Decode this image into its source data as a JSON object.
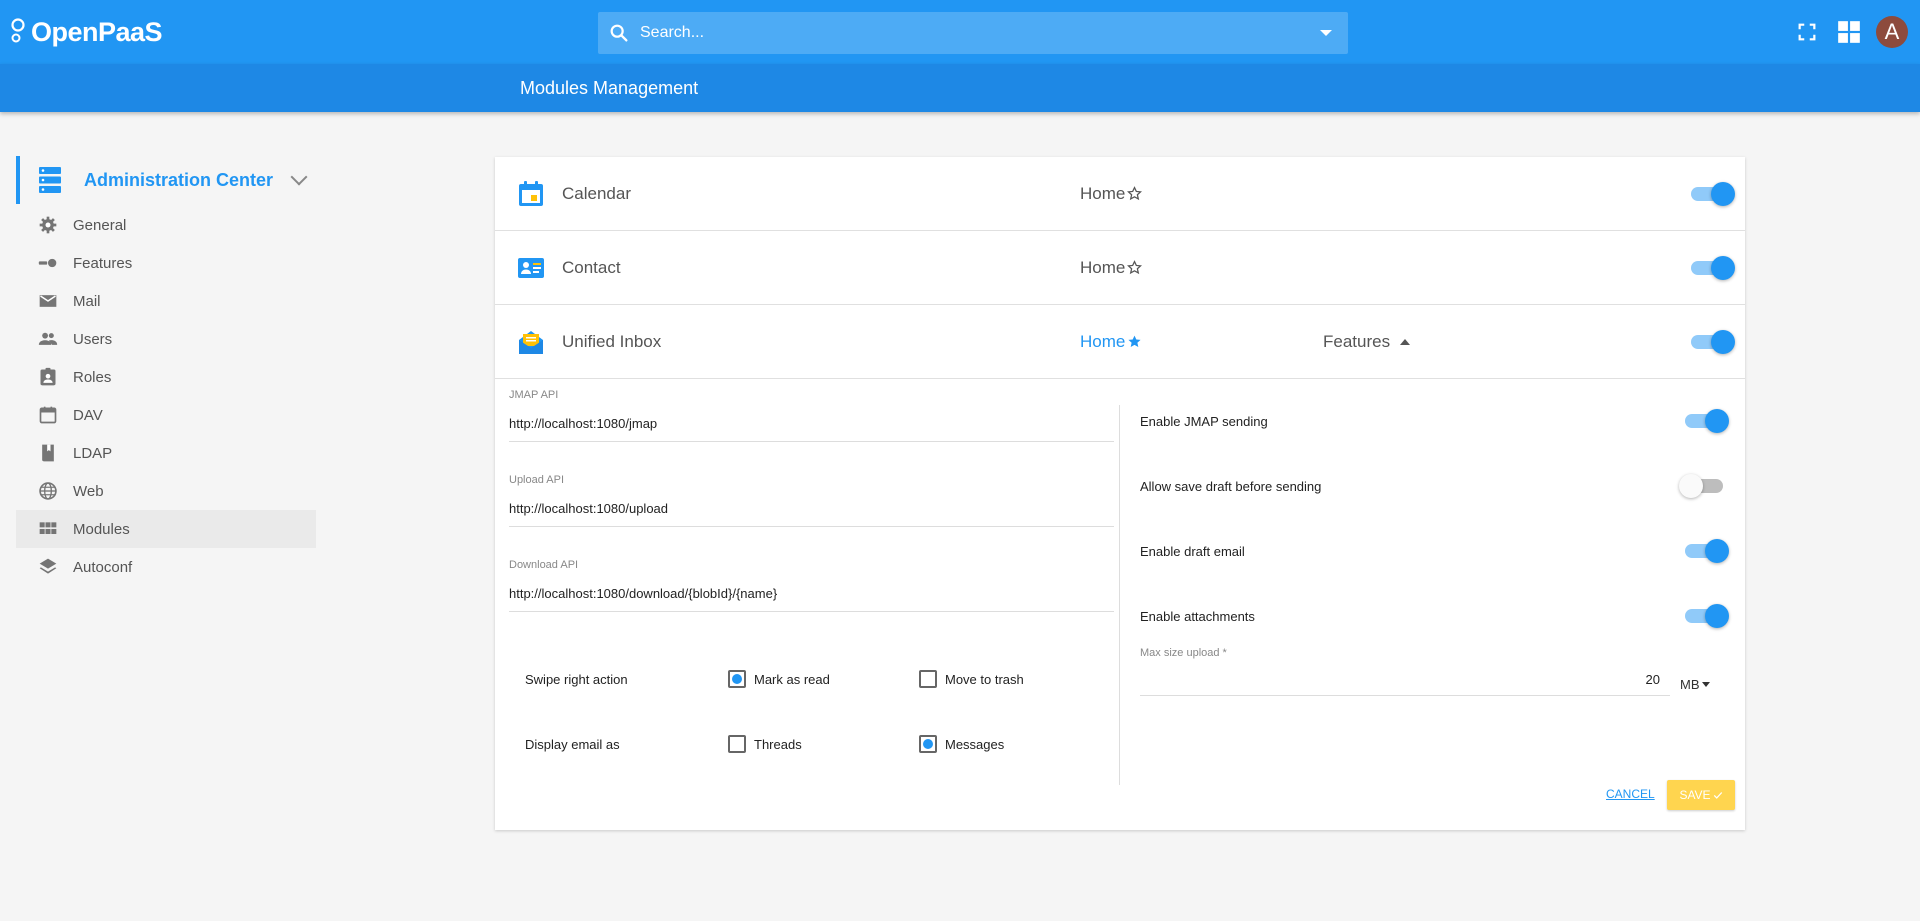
{
  "app": {
    "logo_text": "OpenPaaS"
  },
  "search": {
    "placeholder": "Search..."
  },
  "header": {
    "title": "Modules Management",
    "avatar_letter": "A"
  },
  "sidebar": {
    "title": "Administration Center",
    "items": [
      {
        "label": "General",
        "icon": "gear-icon"
      },
      {
        "label": "Features",
        "icon": "toggle-icon"
      },
      {
        "label": "Mail",
        "icon": "mail-icon"
      },
      {
        "label": "Users",
        "icon": "users-icon"
      },
      {
        "label": "Roles",
        "icon": "roles-icon"
      },
      {
        "label": "DAV",
        "icon": "calendar-icon"
      },
      {
        "label": "LDAP",
        "icon": "book-icon"
      },
      {
        "label": "Web",
        "icon": "globe-icon"
      },
      {
        "label": "Modules",
        "icon": "grid-icon"
      },
      {
        "label": "Autoconf",
        "icon": "layers-icon"
      }
    ]
  },
  "modules": [
    {
      "name": "Calendar",
      "home": "Home",
      "enabled": true
    },
    {
      "name": "Contact",
      "home": "Home",
      "enabled": true
    },
    {
      "name": "Unified Inbox",
      "home": "Home",
      "features_label": "Features",
      "enabled": true
    }
  ],
  "inbox_config": {
    "jmap_api": {
      "label": "JMAP API",
      "value": "http://localhost:1080/jmap"
    },
    "upload_api": {
      "label": "Upload API",
      "value": "http://localhost:1080/upload"
    },
    "download_api": {
      "label": "Download API",
      "value": "http://localhost:1080/download/{blobId}/{name}"
    },
    "swipe_right": {
      "label": "Swipe right action",
      "option1": "Mark as read",
      "option2": "Move to trash",
      "selected": "Mark as read"
    },
    "display_as": {
      "label": "Display email as",
      "option1": "Threads",
      "option2": "Messages",
      "selected": "Messages"
    },
    "settings": [
      {
        "label": "Enable JMAP sending",
        "enabled": true
      },
      {
        "label": "Allow save draft before sending",
        "enabled": false
      },
      {
        "label": "Enable draft email",
        "enabled": true
      },
      {
        "label": "Enable attachments",
        "enabled": true
      }
    ],
    "max_size": {
      "label": "Max size upload *",
      "value": "20",
      "unit": "MB"
    },
    "cancel_label": "CANCEL",
    "save_label": "SAVE"
  },
  "colors": {
    "primary": "#2196f3",
    "subbar": "#1e88e5",
    "save": "#ffd54f",
    "avatar": "#8d4b3d"
  }
}
